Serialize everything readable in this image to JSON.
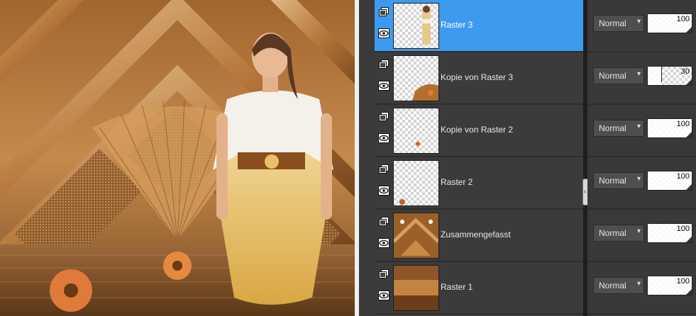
{
  "canvas": {
    "image": "fantasy-woman-walking-in-water-art-deco-background"
  },
  "layers_panel": {
    "layers": [
      {
        "name": "Raster 3",
        "selected": true,
        "blend": "Normal",
        "opacity": 100,
        "thumb": "woman"
      },
      {
        "name": "Kopie von Raster 3",
        "selected": false,
        "blend": "Normal",
        "opacity": 30,
        "thumb": "reflection"
      },
      {
        "name": "Kopie von Raster 2",
        "selected": false,
        "blend": "Normal",
        "opacity": 100,
        "thumb": "small-flower"
      },
      {
        "name": "Raster 2",
        "selected": false,
        "blend": "Normal",
        "opacity": 100,
        "thumb": "flower-corner"
      },
      {
        "name": "Zusammengefasst",
        "selected": false,
        "blend": "Normal",
        "opacity": 100,
        "thumb": "merged-deco"
      },
      {
        "name": "Raster 1",
        "selected": false,
        "blend": "Normal",
        "opacity": 100,
        "thumb": "pattern"
      }
    ]
  },
  "icons": {
    "group": "layer-group-icon",
    "eye": "visibility-eye-icon",
    "dropdown": "chevron-down-icon",
    "collapse": "panel-collapse-icon"
  },
  "colors": {
    "selected": "#3d9bef",
    "panel": "#3b3b3b"
  }
}
